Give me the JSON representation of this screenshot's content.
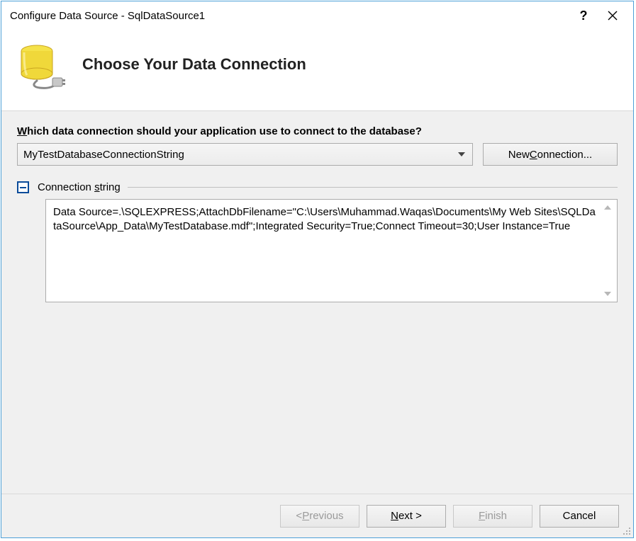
{
  "titlebar": {
    "title": "Configure Data Source - SqlDataSource1"
  },
  "header": {
    "heading": "Choose Your Data Connection"
  },
  "body": {
    "question_prefix": "W",
    "question_rest": "hich data connection should your application use to connect to the database?",
    "combo_value": "MyTestDatabaseConnectionString",
    "new_connection_pre": "New ",
    "new_connection_ul": "C",
    "new_connection_post": "onnection...",
    "expander_label_pre": "Connection ",
    "expander_label_ul": "s",
    "expander_label_post": "tring",
    "connection_string": "Data Source=.\\SQLEXPRESS;AttachDbFilename=\"C:\\Users\\Muhammad.Waqas\\Documents\\My Web Sites\\SQLDataSource\\App_Data\\MyTestDatabase.mdf\";Integrated Security=True;Connect Timeout=30;User Instance=True"
  },
  "footer": {
    "previous_pre": "< ",
    "previous_ul": "P",
    "previous_post": "revious",
    "next_ul": "N",
    "next_post": "ext >",
    "finish_ul": "F",
    "finish_post": "inish",
    "cancel": "Cancel"
  }
}
